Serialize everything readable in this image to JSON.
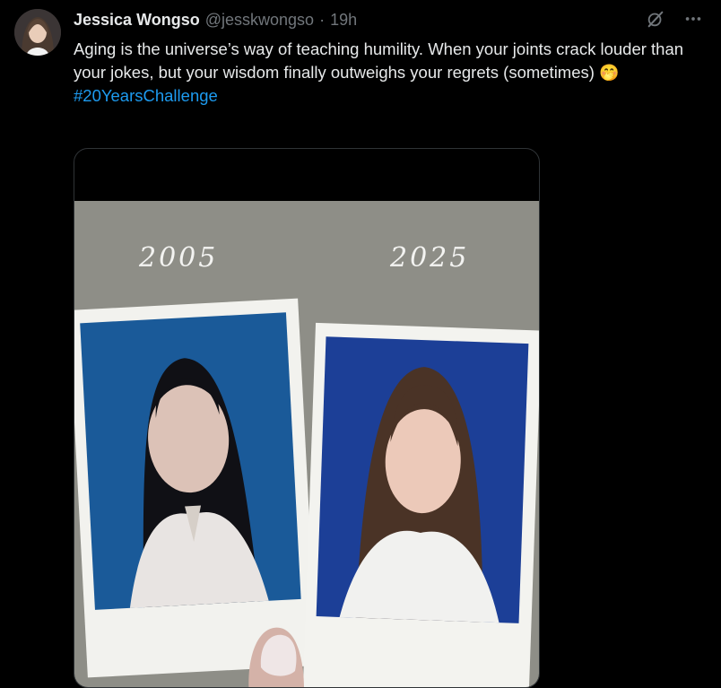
{
  "tweet": {
    "display_name": "Jessica Wongso",
    "handle": "@jesskwongso",
    "separator": "·",
    "time": "19h",
    "text": "Aging is the universe’s way of teaching humility. When your joints crack louder than your jokes, but your wisdom finally outweighs your regrets (sometimes)",
    "emoji": "🤭",
    "hashtag": "#20YearsChallenge"
  },
  "media": {
    "year_left": "2005",
    "year_right": "2025"
  },
  "icons": {
    "grok": "slashed-circle-icon",
    "more": "more-dots-icon"
  },
  "colors": {
    "background": "#000000",
    "text": "#e7e9ea",
    "muted": "#71767b",
    "link": "#1d9bf0"
  }
}
